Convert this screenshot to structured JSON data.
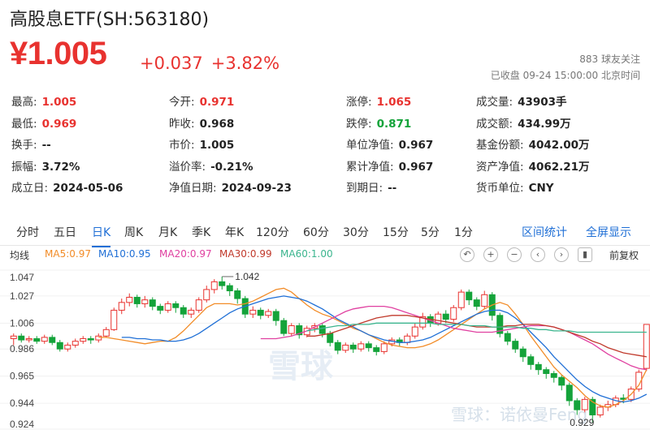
{
  "header": {
    "title": "高股息ETF(SH:563180)",
    "price": "¥1.005",
    "change": "+0.037",
    "change_pct": "+3.82%",
    "followers": "883 球友关注",
    "status": "已收盘 09-24 15:00:00 北京时间"
  },
  "quote_rows": [
    [
      {
        "label": "最高:",
        "value": "1.005",
        "tone": "up"
      },
      {
        "label": "今开:",
        "value": "0.971",
        "tone": "up"
      },
      {
        "label": "涨停:",
        "value": "1.065",
        "tone": "up"
      },
      {
        "label": "成交量:",
        "value": "43903手",
        "tone": ""
      }
    ],
    [
      {
        "label": "最低:",
        "value": "0.969",
        "tone": "up"
      },
      {
        "label": "昨收:",
        "value": "0.968",
        "tone": ""
      },
      {
        "label": "跌停:",
        "value": "0.871",
        "tone": "down"
      },
      {
        "label": "成交额:",
        "value": "434.99万",
        "tone": ""
      }
    ],
    [
      {
        "label": "换手:",
        "value": "--",
        "tone": ""
      },
      {
        "label": "市价:",
        "value": "1.005",
        "tone": ""
      },
      {
        "label": "单位净值:",
        "value": "0.967",
        "tone": ""
      },
      {
        "label": "基金份额:",
        "value": "4042.00万",
        "tone": ""
      }
    ],
    [
      {
        "label": "振幅:",
        "value": "3.72%",
        "tone": ""
      },
      {
        "label": "溢价率:",
        "value": "-0.21%",
        "tone": ""
      },
      {
        "label": "累计净值:",
        "value": "0.967",
        "tone": ""
      },
      {
        "label": "资产净值:",
        "value": "4062.21万",
        "tone": ""
      }
    ],
    [
      {
        "label": "成立日:",
        "value": "2024-05-06",
        "tone": ""
      },
      {
        "label": "净值日期:",
        "value": "2024-09-23",
        "tone": ""
      },
      {
        "label": "到期日:",
        "value": "--",
        "tone": ""
      },
      {
        "label": "货币单位:",
        "value": "CNY",
        "tone": ""
      }
    ]
  ],
  "tabs": {
    "items": [
      "分时",
      "五日",
      "日K",
      "周K",
      "月K",
      "季K",
      "年K",
      "120分",
      "60分",
      "30分",
      "15分",
      "5分",
      "1分"
    ],
    "active": "日K",
    "interval_stats": "区间统计",
    "fullscreen": "全屏显示"
  },
  "ma_bar": {
    "label": "均线",
    "ma5": "MA5:0.97",
    "ma10": "MA10:0.95",
    "ma20": "MA20:0.97",
    "ma30": "MA30:0.99",
    "ma60": "MA60:1.00",
    "adjust": "前复权"
  },
  "tools": {
    "undo": "↶",
    "zoom_in": "+",
    "zoom_out": "−",
    "left": "‹",
    "right": "›",
    "pin": "▮"
  },
  "colors": {
    "up": "#e8322f",
    "down": "#14a33a",
    "accent": "#1f6fd6",
    "ma5": "#f28c28",
    "ma10": "#1f6fd6",
    "ma20": "#e040a0",
    "ma30": "#c0392b",
    "ma60": "#3bb58e"
  },
  "chart_data": {
    "type": "candlestick",
    "ylim": [
      0.924,
      1.047
    ],
    "y_ticks": [
      "1.047",
      "1.027",
      "1.006",
      "0.986",
      "0.965",
      "0.944",
      "0.924"
    ],
    "annotations": {
      "high": "1.042",
      "low": "0.929"
    },
    "watermark_center": "雪球",
    "watermark_corner": "雪球：诺依曼Feng",
    "candles": [
      [
        0.994,
        0.996,
        0.989,
        0.998
      ],
      [
        0.996,
        0.993,
        0.991,
        0.998
      ],
      [
        0.993,
        0.994,
        0.991,
        0.996
      ],
      [
        0.994,
        0.992,
        0.99,
        0.996
      ],
      [
        0.992,
        0.995,
        0.99,
        0.997
      ],
      [
        0.995,
        0.991,
        0.989,
        0.997
      ],
      [
        0.991,
        0.986,
        0.984,
        0.993
      ],
      [
        0.986,
        0.989,
        0.984,
        0.991
      ],
      [
        0.989,
        0.992,
        0.987,
        0.994
      ],
      [
        0.992,
        0.994,
        0.99,
        0.996
      ],
      [
        0.994,
        0.993,
        0.99,
        0.996
      ],
      [
        0.993,
        0.996,
        0.991,
        0.998
      ],
      [
        0.996,
        1.001,
        0.995,
        1.003
      ],
      [
        1.001,
        1.016,
        1.0,
        1.018
      ],
      [
        1.016,
        1.022,
        1.013,
        1.025
      ],
      [
        1.022,
        1.026,
        1.019,
        1.029
      ],
      [
        1.026,
        1.021,
        1.018,
        1.028
      ],
      [
        1.021,
        1.024,
        1.018,
        1.027
      ],
      [
        1.024,
        1.019,
        1.016,
        1.026
      ],
      [
        1.019,
        1.016,
        1.013,
        1.021
      ],
      [
        1.016,
        1.021,
        1.014,
        1.023
      ],
      [
        1.021,
        1.018,
        1.014,
        1.023
      ],
      [
        1.018,
        1.013,
        1.01,
        1.02
      ],
      [
        1.013,
        1.016,
        1.01,
        1.018
      ],
      [
        1.016,
        1.024,
        1.014,
        1.026
      ],
      [
        1.024,
        1.032,
        1.022,
        1.035
      ],
      [
        1.032,
        1.038,
        1.029,
        1.04
      ],
      [
        1.038,
        1.035,
        1.032,
        1.042
      ],
      [
        1.035,
        1.031,
        1.027,
        1.037
      ],
      [
        1.031,
        1.025,
        1.021,
        1.033
      ],
      [
        1.025,
        1.013,
        1.01,
        1.027
      ],
      [
        1.013,
        1.016,
        1.01,
        1.019
      ],
      [
        1.016,
        1.012,
        1.009,
        1.018
      ],
      [
        1.012,
        1.015,
        1.01,
        1.017
      ],
      [
        1.015,
        1.008,
        1.004,
        1.017
      ],
      [
        1.008,
        0.998,
        0.996,
        1.01
      ],
      [
        0.998,
        1.004,
        0.996,
        1.006
      ],
      [
        1.004,
        0.997,
        0.994,
        1.006
      ],
      [
        0.997,
        1.002,
        0.995,
        1.004
      ],
      [
        1.002,
        1.004,
        0.999,
        1.006
      ],
      [
        1.004,
        0.998,
        0.995,
        1.006
      ],
      [
        0.998,
        0.991,
        0.988,
        1.0
      ],
      [
        0.991,
        0.985,
        0.982,
        0.993
      ],
      [
        0.985,
        0.989,
        0.983,
        0.991
      ],
      [
        0.989,
        0.986,
        0.983,
        0.991
      ],
      [
        0.986,
        0.99,
        0.984,
        0.992
      ],
      [
        0.99,
        0.987,
        0.984,
        0.992
      ],
      [
        0.987,
        0.984,
        0.981,
        0.989
      ],
      [
        0.984,
        0.99,
        0.982,
        0.992
      ],
      [
        0.99,
        0.993,
        0.988,
        0.995
      ],
      [
        0.993,
        0.991,
        0.988,
        0.995
      ],
      [
        0.991,
        0.996,
        0.989,
        0.998
      ],
      [
        0.996,
        1.003,
        0.994,
        1.006
      ],
      [
        1.003,
        1.011,
        1.001,
        1.014
      ],
      [
        1.011,
        1.006,
        1.003,
        1.013
      ],
      [
        1.006,
        1.013,
        1.004,
        1.015
      ],
      [
        1.013,
        1.009,
        1.006,
        1.016
      ],
      [
        1.009,
        1.018,
        1.007,
        1.02
      ],
      [
        1.018,
        1.03,
        1.016,
        1.032
      ],
      [
        1.03,
        1.024,
        1.02,
        1.032
      ],
      [
        1.024,
        1.019,
        1.016,
        1.026
      ],
      [
        1.019,
        1.028,
        1.017,
        1.031
      ],
      [
        1.028,
        1.012,
        1.008,
        1.03
      ],
      [
        1.012,
        0.998,
        0.995,
        1.014
      ],
      [
        0.998,
        0.992,
        0.989,
        1.0
      ],
      [
        0.992,
        0.986,
        0.983,
        0.994
      ],
      [
        0.986,
        0.98,
        0.976,
        0.988
      ],
      [
        0.98,
        0.974,
        0.97,
        0.982
      ],
      [
        0.974,
        0.97,
        0.966,
        0.976
      ],
      [
        0.97,
        0.967,
        0.963,
        0.972
      ],
      [
        0.967,
        0.964,
        0.96,
        0.969
      ],
      [
        0.964,
        0.958,
        0.954,
        0.966
      ],
      [
        0.958,
        0.946,
        0.942,
        0.96
      ],
      [
        0.946,
        0.939,
        0.935,
        0.948
      ],
      [
        0.939,
        0.947,
        0.937,
        0.949
      ],
      [
        0.947,
        0.935,
        0.929,
        0.949
      ],
      [
        0.935,
        0.941,
        0.933,
        0.943
      ],
      [
        0.941,
        0.943,
        0.938,
        0.946
      ],
      [
        0.943,
        0.948,
        0.941,
        0.95
      ],
      [
        0.948,
        0.947,
        0.944,
        0.951
      ],
      [
        0.947,
        0.955,
        0.945,
        0.957
      ],
      [
        0.955,
        0.968,
        0.953,
        0.97
      ],
      [
        0.971,
        1.005,
        0.969,
        1.005
      ]
    ],
    "ma_series": [
      {
        "name": "MA5",
        "values": [
          0.995,
          0.995,
          0.994,
          0.993,
          0.992,
          0.991,
          0.99,
          0.991,
          0.992,
          0.992,
          0.995,
          1.0,
          1.006,
          1.012,
          1.018,
          1.021,
          1.021,
          1.021,
          1.02,
          1.021,
          1.023,
          1.026,
          1.029,
          1.032,
          1.033,
          1.03,
          1.025,
          1.02,
          1.016,
          1.013,
          1.011,
          1.008,
          1.005,
          1.002,
          1.0,
          0.997,
          0.994,
          0.991,
          0.989,
          0.988,
          0.987,
          0.987,
          0.988,
          0.99,
          0.993,
          0.997,
          1.001,
          1.005,
          1.009,
          1.013,
          1.017,
          1.02,
          1.022,
          1.02,
          1.013,
          1.005,
          0.996,
          0.988,
          0.98,
          0.972,
          0.966,
          0.961,
          0.956,
          0.95,
          0.945,
          0.942,
          0.941,
          0.943,
          0.946,
          0.951,
          0.958,
          0.97
        ]
      },
      {
        "name": "MA10",
        "values": [
          0.995,
          0.995,
          0.994,
          0.994,
          0.993,
          0.993,
          0.992,
          0.992,
          0.993,
          0.995,
          0.998,
          1.002,
          1.006,
          1.01,
          1.014,
          1.017,
          1.019,
          1.021,
          1.023,
          1.025,
          1.026,
          1.027,
          1.026,
          1.025,
          1.023,
          1.02,
          1.017,
          1.013,
          1.009,
          1.006,
          1.003,
          1.0,
          0.997,
          0.995,
          0.993,
          0.992,
          0.991,
          0.991,
          0.992,
          0.993,
          0.995,
          0.998,
          1.001,
          1.004,
          1.007,
          1.01,
          1.013,
          1.015,
          1.016,
          1.016,
          1.014,
          1.01,
          1.005,
          0.999,
          0.993,
          0.987,
          0.98,
          0.974,
          0.968,
          0.962,
          0.957,
          0.953,
          0.95,
          0.948,
          0.946,
          0.945,
          0.946,
          0.948,
          0.951
        ]
      },
      {
        "name": "MA20",
        "values": [
          0.994,
          0.994,
          0.994,
          0.995,
          0.996,
          0.998,
          1.0,
          1.003,
          1.006,
          1.009,
          1.012,
          1.015,
          1.017,
          1.018,
          1.019,
          1.019,
          1.019,
          1.018,
          1.016,
          1.014,
          1.012,
          1.01,
          1.008,
          1.006,
          1.004,
          1.002,
          1.001,
          1.0,
          0.999,
          0.999,
          0.999,
          1.0,
          1.001,
          1.002,
          1.003,
          1.004,
          1.004,
          1.004,
          1.003,
          1.001,
          0.999,
          0.996,
          0.993,
          0.99,
          0.986,
          0.982,
          0.979,
          0.976,
          0.973,
          0.971,
          0.97
        ]
      },
      {
        "name": "MA30",
        "values": [
          0.996,
          0.996,
          0.997,
          0.998,
          1.0,
          1.002,
          1.004,
          1.006,
          1.008,
          1.01,
          1.011,
          1.012,
          1.012,
          1.012,
          1.011,
          1.01,
          1.009,
          1.008,
          1.007,
          1.006,
          1.005,
          1.004,
          1.003,
          1.003,
          1.003,
          1.003,
          1.004,
          1.004,
          1.005,
          1.005,
          1.005,
          1.004,
          1.003,
          1.001,
          0.999,
          0.997,
          0.995,
          0.992,
          0.99,
          0.987,
          0.985,
          0.983,
          0.982,
          0.981,
          0.98
        ]
      },
      {
        "name": "MA60",
        "values": [
          1.0,
          1.001,
          1.002,
          1.003,
          1.004,
          1.004,
          1.005,
          1.005,
          1.005,
          1.006,
          1.006,
          1.006,
          1.006,
          1.006,
          1.006,
          1.006,
          1.006,
          1.005,
          1.005,
          1.005,
          1.005,
          1.004,
          1.004,
          1.004,
          1.003,
          1.003,
          1.003,
          1.003,
          1.002,
          1.002,
          1.001,
          1.001,
          1.0,
          1.0,
          1.0,
          0.999,
          0.999,
          0.999,
          0.999,
          0.999,
          0.999,
          0.999,
          0.999,
          0.999,
          0.999
        ]
      }
    ]
  }
}
